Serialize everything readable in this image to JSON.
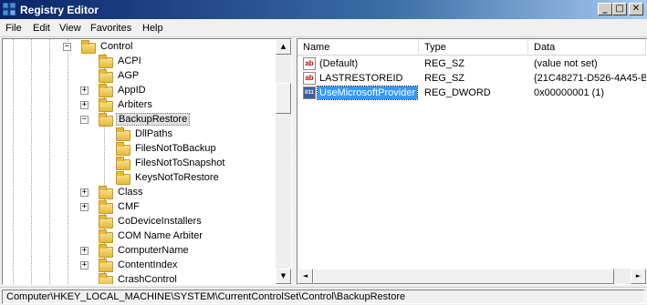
{
  "window": {
    "title": "Registry Editor",
    "minimize": "_",
    "maximize": "□",
    "close": "✕"
  },
  "menu": [
    "File",
    "Edit",
    "View",
    "Favorites",
    "Help"
  ],
  "tree": {
    "root": {
      "label": "Control",
      "expander": "−"
    },
    "items": [
      {
        "label": "ACPI",
        "expander": ""
      },
      {
        "label": "AGP",
        "expander": ""
      },
      {
        "label": "AppID",
        "expander": "+"
      },
      {
        "label": "Arbiters",
        "expander": "+"
      },
      {
        "label": "BackupRestore",
        "expander": "−",
        "selected": true
      },
      {
        "label": "DllPaths",
        "child": true
      },
      {
        "label": "FilesNotToBackup",
        "child": true
      },
      {
        "label": "FilesNotToSnapshot",
        "child": true
      },
      {
        "label": "KeysNotToRestore",
        "child": true
      },
      {
        "label": "Class",
        "expander": "+"
      },
      {
        "label": "CMF",
        "expander": "+"
      },
      {
        "label": "CoDeviceInstallers",
        "expander": ""
      },
      {
        "label": "COM Name Arbiter",
        "expander": ""
      },
      {
        "label": "ComputerName",
        "expander": "+"
      },
      {
        "label": "ContentIndex",
        "expander": "+"
      },
      {
        "label": "CrashControl",
        "expander": ""
      }
    ]
  },
  "values_table": {
    "columns": [
      "Name",
      "Type",
      "Data"
    ],
    "rows": [
      {
        "icon": "string-value-icon",
        "icon_glyph": "ab",
        "name": "(Default)",
        "type": "REG_SZ",
        "data": "(value not set)"
      },
      {
        "icon": "string-value-icon",
        "icon_glyph": "ab",
        "name": "LASTRESTOREID",
        "type": "REG_SZ",
        "data": "{21C48271-D526-4A45-B"
      },
      {
        "icon": "binary-value-icon",
        "icon_glyph": "011",
        "name": "UseMicrosoftProvider",
        "type": "REG_DWORD",
        "data": "0x00000001 (1)",
        "selected": true
      }
    ]
  },
  "scroll": {
    "up": "▲",
    "down": "▼",
    "left": "◄",
    "right": "►"
  },
  "status": {
    "path": "Computer\\HKEY_LOCAL_MACHINE\\SYSTEM\\CurrentControlSet\\Control\\BackupRestore"
  },
  "colors": {
    "selection": "#3399ff",
    "titlebar": "#0a246a"
  }
}
